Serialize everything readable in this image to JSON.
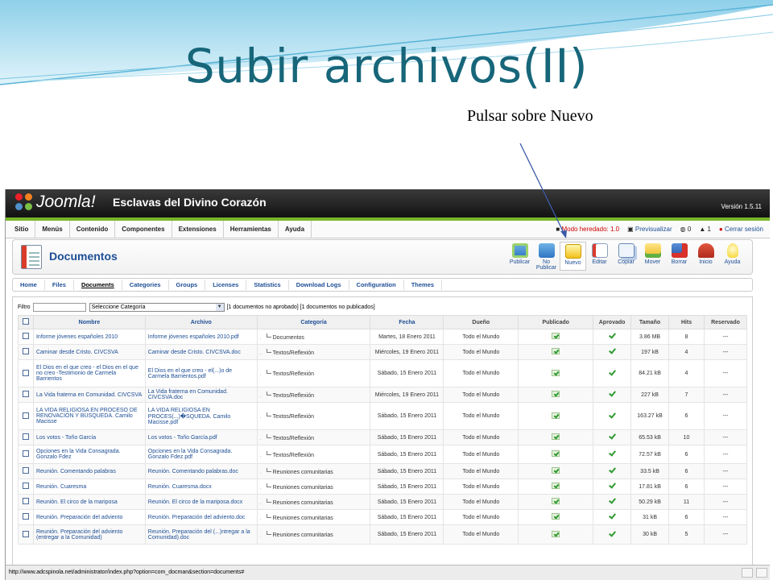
{
  "slide": {
    "title": "Subir archivos(II)",
    "note": "Pulsar sobre Nuevo"
  },
  "colors": {
    "title": "#17667a",
    "joomla_green": "#78b62a",
    "link": "#1d4e95"
  },
  "app": {
    "logo_text": "Joomla!",
    "site_name": "Esclavas del Divino Corazón",
    "version": "Versión 1.5.11"
  },
  "menu": {
    "items": [
      "Sitio",
      "Menús",
      "Contenido",
      "Componentes",
      "Extensiones",
      "Herramientas",
      "Ayuda"
    ],
    "legacy": "Modo heredado: 1.0",
    "preview": "Previsualizar",
    "count_a": "0",
    "count_b": "1",
    "logout": "Cerrar sesión"
  },
  "toolbar": {
    "title": "Documentos",
    "buttons": [
      {
        "label": "Publicar",
        "icon": "publish-icon"
      },
      {
        "label": "No Publicar",
        "icon": "unpublish-icon"
      },
      {
        "label": "Nuevo",
        "icon": "new-icon"
      },
      {
        "label": "Editar",
        "icon": "edit-icon"
      },
      {
        "label": "Copiar",
        "icon": "copy-icon"
      },
      {
        "label": "Mover",
        "icon": "move-icon"
      },
      {
        "label": "Borrar",
        "icon": "delete-icon"
      },
      {
        "label": "Inicio",
        "icon": "home-icon"
      },
      {
        "label": "Ayuda",
        "icon": "help-icon"
      }
    ]
  },
  "submenu": {
    "items": [
      "Home",
      "Files",
      "Documents",
      "Categories",
      "Groups",
      "Licenses",
      "Statistics",
      "Download Logs",
      "Configuration",
      "Themes"
    ],
    "active": "Documents"
  },
  "filter": {
    "label": "Filtro",
    "input_value": "",
    "category_select": "Seleccione Categoría",
    "summary": "[1 documentos no aprobado] [1 documentos no publicados]"
  },
  "table": {
    "columns": [
      "Nombre",
      "Archivo",
      "Categoría",
      "Fecha",
      "Dueño",
      "Publicado",
      "Aprovado",
      "Tamaño",
      "Hits",
      "Reservado"
    ],
    "rows": [
      {
        "nombre": "Informe jóvenes españoles 2010",
        "archivo": "Informe jóvenes españoles 2010.pdf",
        "categoria": "Documentos",
        "fecha": "Martes, 18 Enero 2011",
        "dueno": "Todo el Mundo",
        "tamano": "3.86 MB",
        "hits": "8",
        "reservado": "---"
      },
      {
        "nombre": "Caminar desde Cristo. CIVCSVA",
        "archivo": "Caminar desde Cristo. CIVCSVA.doc",
        "categoria": "Textos/Reflexión",
        "fecha": "Miércoles, 19 Enero 2011",
        "dueno": "Todo el Mundo",
        "tamano": "197 kB",
        "hits": "4",
        "reservado": "---"
      },
      {
        "nombre": "El Dios en el que creo - el Dios en el que no creo -Testimonio de Carmela Barrientos",
        "archivo": "El Dios en el que creo - el(...)o de Carmela Barrientos.pdf",
        "categoria": "Textos/Reflexión",
        "fecha": "Sábado, 15 Enero 2011",
        "dueno": "Todo el Mundo",
        "tamano": "84.21 kB",
        "hits": "4",
        "reservado": "---"
      },
      {
        "nombre": "La Vida fraterna en Comunidad. CIVCSVA",
        "archivo": "La Vida fraterna en Comunidad. CIVCSVA.doc",
        "categoria": "Textos/Reflexión",
        "fecha": "Miércoles, 19 Enero 2011",
        "dueno": "Todo el Mundo",
        "tamano": "227 kB",
        "hits": "7",
        "reservado": "---"
      },
      {
        "nombre": "LA VIDA RELIGIOSA EN PROCESO DE RENOVACIÓN Y BÚSQUEDA. Camilo Macisse",
        "archivo": "LA VIDA RELIGIOSA EN PROCES(...)�SQUEDA. Camilo Macisse.pdf",
        "categoria": "Textos/Reflexión",
        "fecha": "Sábado, 15 Enero 2011",
        "dueno": "Todo el Mundo",
        "tamano": "163.27 kB",
        "hits": "6",
        "reservado": "---"
      },
      {
        "nombre": "Los votos - Toño García",
        "archivo": "Los votos - Toño García.pdf",
        "categoria": "Textos/Reflexión",
        "fecha": "Sábado, 15 Enero 2011",
        "dueno": "Todo el Mundo",
        "tamano": "65.53 kB",
        "hits": "10",
        "reservado": "---"
      },
      {
        "nombre": "Opciones en la Vida Consagrada. Gonzalo Fdez",
        "archivo": "Opciones en la Vida Consagrada. Gonzalo Fdez.pdf",
        "categoria": "Textos/Reflexión",
        "fecha": "Sábado, 15 Enero 2011",
        "dueno": "Todo el Mundo",
        "tamano": "72.57 kB",
        "hits": "6",
        "reservado": "---"
      },
      {
        "nombre": "Reunión. Comentando palabras",
        "archivo": "Reunión. Comentando palabras.doc",
        "categoria": "Reuniones comunitarias",
        "fecha": "Sábado, 15 Enero 2011",
        "dueno": "Todo el Mundo",
        "tamano": "33.5 kB",
        "hits": "6",
        "reservado": "---"
      },
      {
        "nombre": "Reunión. Cuaresma",
        "archivo": "Reunión. Cuaresma.docx",
        "categoria": "Reuniones comunitarias",
        "fecha": "Sábado, 15 Enero 2011",
        "dueno": "Todo el Mundo",
        "tamano": "17.81 kB",
        "hits": "6",
        "reservado": "---"
      },
      {
        "nombre": "Reunión. El circo de la mariposa",
        "archivo": "Reunión. El circo de la mariposa.docx",
        "categoria": "Reuniones comunitarias",
        "fecha": "Sábado, 15 Enero 2011",
        "dueno": "Todo el Mundo",
        "tamano": "50.29 kB",
        "hits": "11",
        "reservado": "---"
      },
      {
        "nombre": "Reunión. Preparación del adviento",
        "archivo": "Reunión. Preparación del adviento.doc",
        "categoria": "Reuniones comunitarias",
        "fecha": "Sábado, 15 Enero 2011",
        "dueno": "Todo el Mundo",
        "tamano": "31 kB",
        "hits": "6",
        "reservado": "---"
      },
      {
        "nombre": "Reunión. Preparación del adviento (entregar a la Comunidad)",
        "archivo": "Reunión. Preparación del (...)ntregar a la Comunidad).doc",
        "categoria": "Reuniones comunitarias",
        "fecha": "Sábado, 15 Enero 2011",
        "dueno": "Todo el Mundo",
        "tamano": "30 kB",
        "hits": "5",
        "reservado": "---"
      }
    ]
  },
  "statusbar": {
    "url": "http://www.adcspinola.net/administrator/index.php?option=com_docman&section=documents#"
  }
}
